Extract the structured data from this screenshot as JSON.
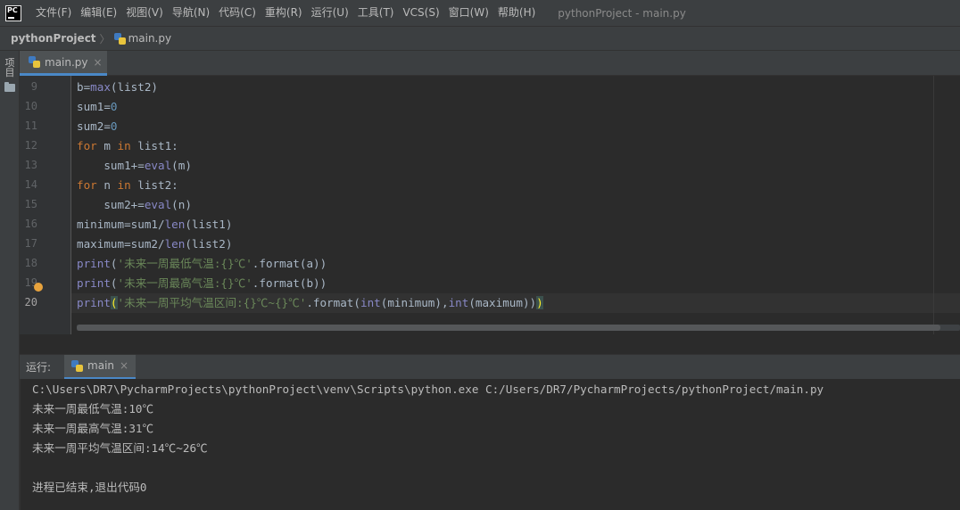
{
  "app": {
    "logo_text": "PC",
    "window_title": "pythonProject - main.py"
  },
  "menu": [
    {
      "label": "文件(F)"
    },
    {
      "label": "编辑(E)"
    },
    {
      "label": "视图(V)"
    },
    {
      "label": "导航(N)"
    },
    {
      "label": "代码(C)"
    },
    {
      "label": "重构(R)"
    },
    {
      "label": "运行(U)"
    },
    {
      "label": "工具(T)"
    },
    {
      "label": "VCS(S)"
    },
    {
      "label": "窗口(W)"
    },
    {
      "label": "帮助(H)"
    }
  ],
  "breadcrumb": {
    "project": "pythonProject",
    "separator": "〉",
    "file": "main.py"
  },
  "left_strip": {
    "project_tool": "项目"
  },
  "editor_tab": {
    "label": "main.py",
    "close": "×"
  },
  "editor": {
    "current_line": 20,
    "lines": [
      {
        "num": "9",
        "code": "b=max(list2)"
      },
      {
        "num": "10",
        "code": "sum1=0"
      },
      {
        "num": "11",
        "code": "sum2=0"
      },
      {
        "num": "12",
        "code": "for m in list1:"
      },
      {
        "num": "13",
        "code": "    sum1+=eval(m)"
      },
      {
        "num": "14",
        "code": "for n in list2:"
      },
      {
        "num": "15",
        "code": "    sum2+=eval(n)"
      },
      {
        "num": "16",
        "code": "minimum=sum1/len(list1)"
      },
      {
        "num": "17",
        "code": "maximum=sum2/len(list2)"
      },
      {
        "num": "18",
        "code": "print('未来一周最低气温:{}℃'.format(a))"
      },
      {
        "num": "19",
        "code": "print('未来一周最高气温:{}℃'.format(b))"
      },
      {
        "num": "20",
        "code": "print('未来一周平均气温区间:{}℃~{}℃'.format(int(minimum),int(maximum)))"
      }
    ]
  },
  "run_panel": {
    "label": "运行:",
    "tab_label": "main",
    "tab_close": "×",
    "console": [
      "C:\\Users\\DR7\\PycharmProjects\\pythonProject\\venv\\Scripts\\python.exe C:/Users/DR7/PycharmProjects/pythonProject/main.py",
      "未来一周最低气温:10℃",
      "未来一周最高气温:31℃",
      "未来一周平均气温区间:14℃~26℃",
      "",
      "进程已结束,退出代码0"
    ]
  },
  "colors": {
    "background": "#2b2b2b",
    "chrome": "#3c3f41",
    "keyword": "#cc7832",
    "builtin": "#8888c6",
    "number": "#6897bb",
    "string": "#6a8759",
    "accent": "#4a88c7"
  },
  "icons": [
    "pycharm-logo-icon",
    "python-file-icon",
    "folder-icon",
    "close-icon",
    "lightbulb-icon"
  ]
}
